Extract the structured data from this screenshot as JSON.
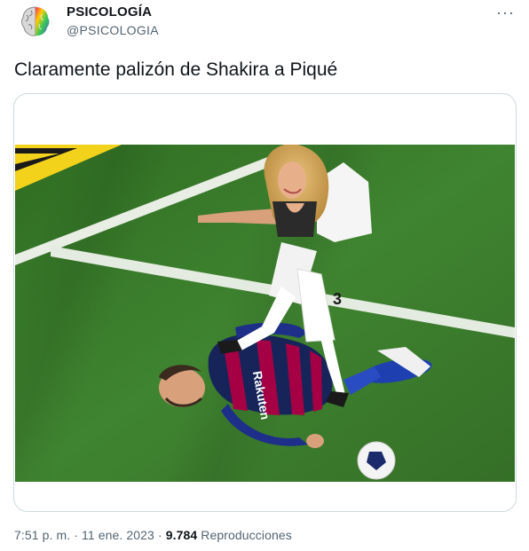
{
  "author": {
    "display_name": "PSICOLOGÍA",
    "handle": "@PSICOLOGIA",
    "avatar_icon": "brain-icon"
  },
  "tweet": {
    "text": "Claramente palizón de Shakira a Piqué"
  },
  "menu": {
    "more_label": "···"
  },
  "meta": {
    "time": "7:51 p. m.",
    "separator": "·",
    "date": "11 ene. 2023",
    "views_count": "9.784",
    "views_label": "Reproducciones"
  },
  "colors": {
    "text_primary": "#0f1419",
    "text_secondary": "#536471",
    "border": "#cfd9de",
    "pitch_green": "#3d7a2b"
  }
}
